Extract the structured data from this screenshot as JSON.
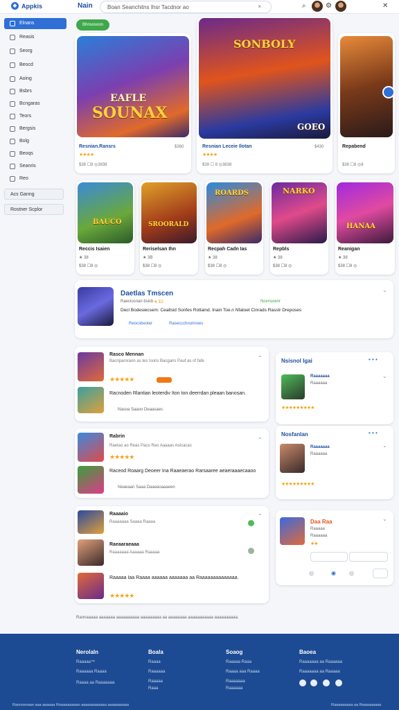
{
  "header": {
    "logo": "Appkis",
    "nav_title": "Nain",
    "search_text": "Boan Seanchitns Ihsr Tacdnor ao",
    "search_clear": "×"
  },
  "sidebar": {
    "items": [
      {
        "label": "Elnans"
      },
      {
        "label": "Reasis"
      },
      {
        "label": "Seorg"
      },
      {
        "label": "Beocd"
      },
      {
        "label": "Aoing"
      },
      {
        "label": "Bsbrs"
      },
      {
        "label": "Bcngaras"
      },
      {
        "label": "Teors"
      },
      {
        "label": "Bergsis"
      },
      {
        "label": "Bolg"
      },
      {
        "label": "Beoqs"
      },
      {
        "label": "Seanris"
      },
      {
        "label": "Reo"
      }
    ],
    "buttons": [
      "Acs Ganng",
      "Rostner Scplor"
    ]
  },
  "pill": "Bhnsosoon",
  "featured": [
    {
      "art_title": "SOUNAX",
      "art_sub": "EAFLE",
      "title": "Resnian.Ransrs",
      "price": "$360",
      "stars": "★★★★",
      "meta": "$38  ☐8  ◎3838"
    },
    {
      "art_title": "SONBOLY",
      "art_sub": "GOEO",
      "title": "Resnian Leceie Ilotan",
      "price": "$430",
      "stars": "★★★★",
      "meta": "$39  ☐ 8  ◎3838"
    },
    {
      "art_title": "",
      "art_sub": "",
      "title": "Repabend",
      "price": "",
      "stars": "",
      "meta": "$38  ☐8  ◎8"
    }
  ],
  "tiles": [
    {
      "art": "BAUCO",
      "title": "Reccis Isaien",
      "rating": "★ 38",
      "meta": "$38  ☐8  ◎"
    },
    {
      "art": "SROORALD",
      "title": "Reriselsan Ihn",
      "rating": "★ 3B",
      "meta": "$38  ☐8  ◎"
    },
    {
      "art": "ROARDS",
      "title": "Recpah Cadn Ias",
      "rating": "★ 38",
      "meta": "$38  ☐8  ◎"
    },
    {
      "art": "NARKO",
      "title": "Repbls",
      "rating": "★ 38",
      "meta": "$38  ☐8  ◎"
    },
    {
      "art": "HANAA",
      "title": "Reanigan",
      "rating": "★ 38",
      "meta": "$38  ☐8  ◎"
    }
  ],
  "banner": {
    "title": "Daetlas Tmscen",
    "sub": "Raeciosnan bsicb",
    "rating": "★ $3",
    "desc": "Decl Bodesiecsem: Cealtsid Sonfes Rotlaind. Inain Toe.n Nfatoet Cinrads Rasstr Dreposes",
    "tag1": "Reocsbeoter",
    "tag2": "Raseccchnonnoes",
    "right": "Ncensoenr"
  },
  "reviews1": {
    "title": "Rasco Mennan",
    "desc": "Bacnparoraon as tes Isoris Bacgans Pauf as of fafe",
    "stars": "★★★★★",
    "text": "Racnoden Rlantian leoterdiv Iton ton deerrdan pleaan banosan.",
    "foot": "Nasoa Saaoo   Deaasaes"
  },
  "reviews2": {
    "title": "Rabrin",
    "desc": "Raetao ao Reas Paco Reo Aaaaas Astcacas",
    "stars": "★★★★★",
    "text": "Raceod Roaarg Deoeer Ina Raaeaerao Rarsaaree aeaeraaaecaaoo",
    "foot": "Neaeaan Saaa   Daaeaoaaaeen"
  },
  "reviews3": {
    "item1_title": "Raaaaio",
    "item1_sub": "Raaaaaaa Saaaa Raaaa",
    "item2_title": "Raeaaraeaaa",
    "item2_sub": "Raaaaaaa Aaaaaa Raaaaa",
    "item3_text": "Raaaaa Iaa Raaaa aaaaaa aaaaaaa aa Raaaaaaaaaaaaaa.",
    "stars": "★★★★★"
  },
  "side_panels": [
    {
      "title": "Nsisnol Igai",
      "item": "Raaaaaaa",
      "sub": "Raaaaaa",
      "stars": "★★★★★★★★★"
    },
    {
      "title": "Nosfanlan",
      "item": "Raaaaaaa",
      "sub": "Raaaaaa",
      "stars": "★★★★★★★★★"
    },
    {
      "title": "Daa Raa",
      "item": "Raaaaa",
      "sub": "Raaaaaa",
      "stars": "★★"
    }
  ],
  "note": "Rannaaaaa aaaaaaa aaaaaaaaaa aaaaaaaaa aa aaaaaaaa aaaaaaaaaaa aaaaaaaaaa.",
  "footer": {
    "col1_title": "Nerolaln",
    "col1_items": [
      "Raaaaa™",
      "Raaaaaa Raaaa",
      "Raaaa aa Raaaaaaa"
    ],
    "col2_title": "Boala",
    "col2_items": [
      "Raaaa",
      "Raaaaaa",
      "Raaaaa",
      "Raaa"
    ],
    "col3_title": "Soaog",
    "col3_items": [
      "Raaaaa Raaa",
      "Raaaa aaa Raaaa",
      "Raaaaaaa",
      "Raaaaaa"
    ],
    "col4_title": "Baoea",
    "col4_items": [
      "Raaaaaaa aa Raaaaaa",
      "Raaaaaaa aa Raaaaa"
    ],
    "copyright": "Rasnosoaae aaa aaaaaa Roaaaaaaaao aaaaaaaaaaaa aaaaaaaaaa",
    "copyright2": "Raaaaaaaaa aa Raaaaaaaaa"
  }
}
